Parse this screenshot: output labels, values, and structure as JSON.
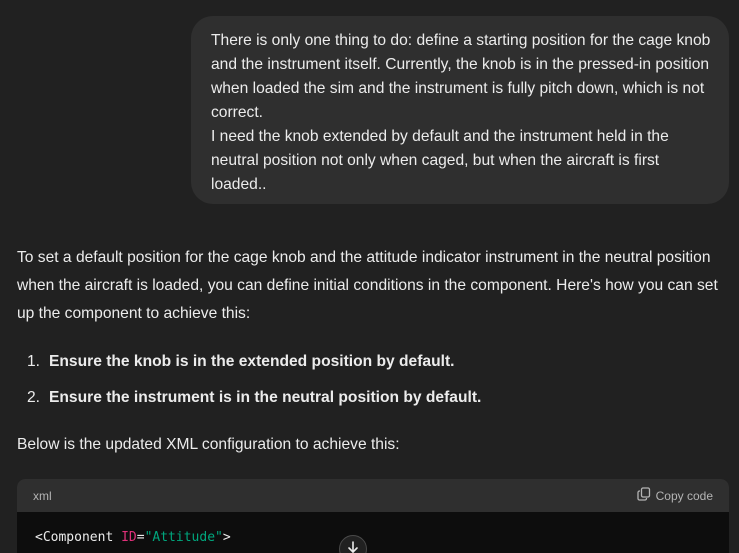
{
  "user_message": {
    "paragraph1": "There is only one thing to do: define a starting position for the cage knob and the instrument itself. Currently, the knob is in the pressed-in position when loaded the sim and the instrument is fully pitch down, which is not correct.",
    "paragraph2": "I need the knob extended by default and the instrument held in the neutral position not only when caged, but when the aircraft is first loaded.."
  },
  "assistant_message": {
    "intro": "To set a default position for the cage knob and the attitude indicator instrument in the neutral position when the aircraft is loaded, you can define initial conditions in the component. Here's how you can set up the component to achieve this:",
    "steps": [
      {
        "num": "1.",
        "text": "Ensure the knob is in the extended position by default."
      },
      {
        "num": "2.",
        "text": "Ensure the instrument is in the neutral position by default."
      }
    ],
    "below": "Below is the updated XML configuration to achieve this:"
  },
  "code_block": {
    "language": "xml",
    "copy_label": "Copy code",
    "line1": {
      "open": "<Component ",
      "attr": "ID",
      "eq": "=",
      "value": "\"Attitude\"",
      "close": ">"
    }
  },
  "icons": {
    "copy": "copy-icon",
    "scroll_down": "arrow-down-icon"
  },
  "colors": {
    "background": "#212121",
    "user_bubble": "#2f2f2f",
    "code_bg": "#0d0d0d",
    "xml_attr": "#df3079",
    "xml_string": "#00a67d"
  }
}
